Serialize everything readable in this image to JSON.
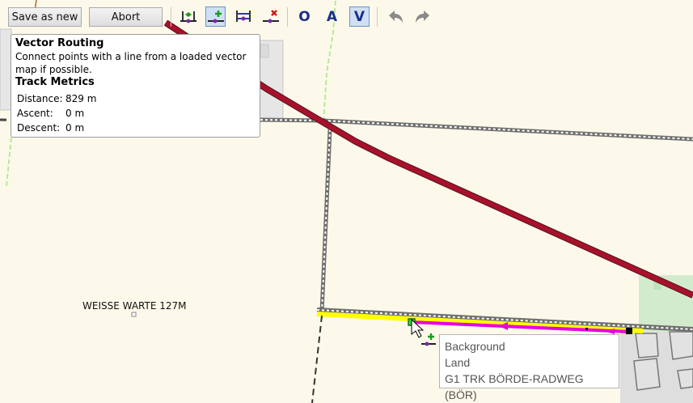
{
  "toolbar": {
    "save_as_new": "Save as new",
    "abort": "Abort",
    "tools": [
      {
        "name": "route-edit-icon",
        "active": false
      },
      {
        "name": "add-point-icon",
        "active": true
      },
      {
        "name": "insert-point-icon",
        "active": false
      },
      {
        "name": "delete-point-icon",
        "active": false
      }
    ],
    "modes": [
      "O",
      "A",
      "V"
    ],
    "active_mode": "V",
    "undo_icon": "undo-icon",
    "redo_icon": "redo-icon"
  },
  "info_panel": {
    "title": "Vector Routing",
    "description": "Connect points with a line from a loaded vector map if possible.",
    "metrics_title": "Track Metrics",
    "metrics": [
      {
        "label": "Distance:",
        "value": "829 m"
      },
      {
        "label": "Ascent:",
        "value": "0 m"
      },
      {
        "label": "Descent:",
        "value": "0 m"
      }
    ]
  },
  "map": {
    "place_label": "WEISSE WARTE 127M",
    "colors": {
      "background": "#fcf9ea",
      "main_road": "#a8112b",
      "track_highlight": "#ffff00",
      "route": "#e600e6",
      "vegetation": "#c8ecc3"
    }
  },
  "tooltip": {
    "lines": [
      "Background",
      "Land",
      "G1 TRK BÖRDE-RADWEG (BÖR)"
    ]
  }
}
